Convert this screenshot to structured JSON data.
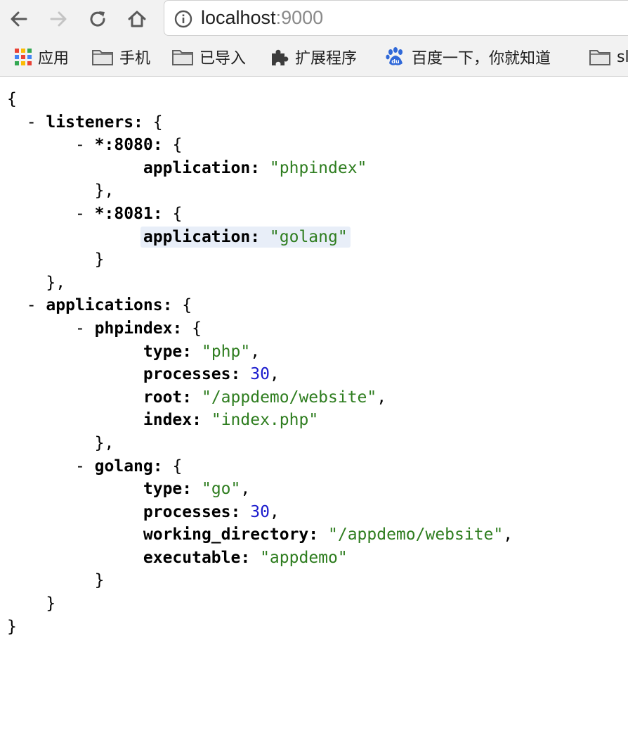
{
  "browser": {
    "url_host": "localhost",
    "url_port": ":9000"
  },
  "bookmarks": [
    {
      "label": "应用",
      "icon": "apps-grid-icon"
    },
    {
      "label": "手机",
      "icon": "folder-icon"
    },
    {
      "label": "已导入",
      "icon": "folder-icon"
    },
    {
      "label": "扩展程序",
      "icon": "puzzle-icon"
    },
    {
      "label": "百度一下，你就知道",
      "icon": "baidu-icon"
    },
    {
      "label": "sl",
      "icon": "folder-icon"
    }
  ],
  "json_view": {
    "open_brace": "{",
    "close_brace": "}",
    "listeners_key": "listeners",
    "listeners": [
      {
        "key": "*:8080",
        "field": "application",
        "value": "\"phpindex\""
      },
      {
        "key": "*:8081",
        "field": "application",
        "value": "\"golang\""
      }
    ],
    "applications_key": "applications",
    "phpindex": {
      "key": "phpindex",
      "type_key": "type",
      "type_val": "\"php\"",
      "processes_key": "processes",
      "processes_val": "30",
      "root_key": "root",
      "root_val": "\"/appdemo/website\"",
      "index_key": "index",
      "index_val": "\"index.php\""
    },
    "golang": {
      "key": "golang",
      "type_key": "type",
      "type_val": "\"go\"",
      "processes_key": "processes",
      "processes_val": "30",
      "wd_key": "working_directory",
      "wd_val": "\"/appdemo/website\"",
      "exe_key": "executable",
      "exe_val": "\"appdemo\""
    }
  },
  "colors": {
    "string": "#2e7d1f",
    "number": "#1a1acd",
    "highlight": "#e8eef8"
  }
}
